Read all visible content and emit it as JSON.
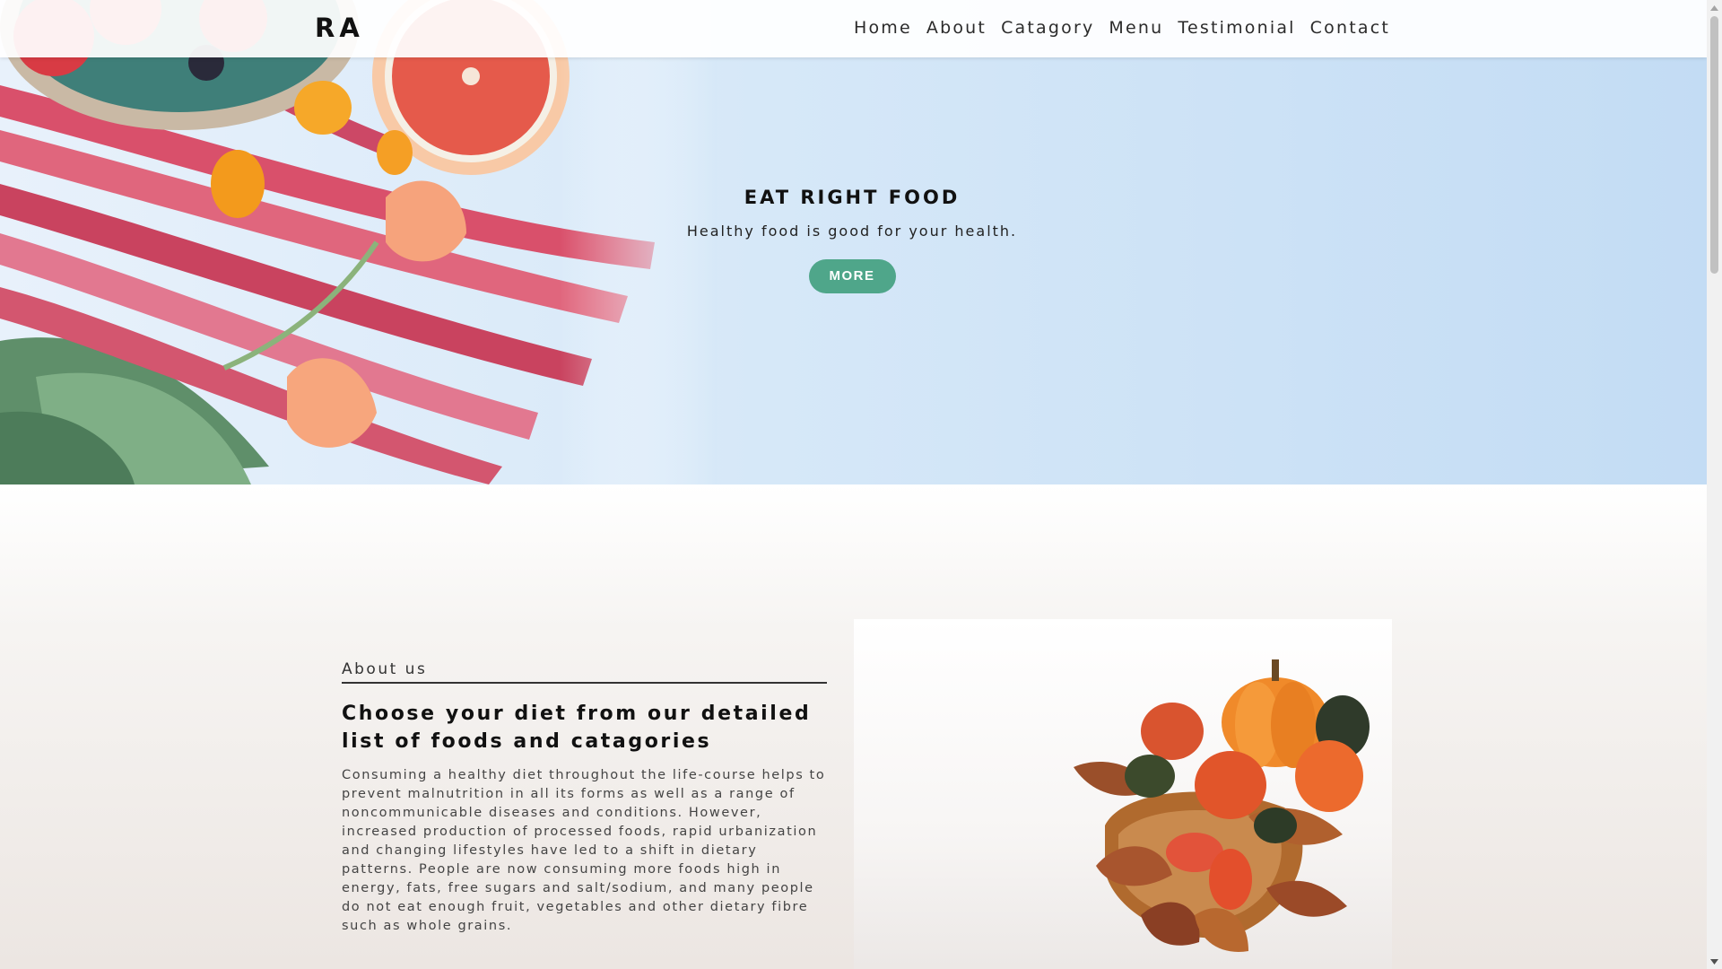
{
  "header": {
    "logo": "RA",
    "nav": [
      {
        "label": "Home"
      },
      {
        "label": "About"
      },
      {
        "label": "Catagory"
      },
      {
        "label": "Menu"
      },
      {
        "label": "Testimonial"
      },
      {
        "label": "Contact"
      }
    ]
  },
  "hero": {
    "title": "EAT RIGHT FOOD",
    "subtitle": "Healthy food is good for your health.",
    "button_label": "MORE",
    "image_icon": "fruits-rhubarb-flowers-photo"
  },
  "about": {
    "kicker": "About us",
    "heading": "Choose your diet from our detailed list of foods and catagories",
    "body": "Consuming a healthy diet throughout the life-course helps to prevent malnutrition in all its forms as well as a range of noncommunicable diseases and conditions. However, increased production of processed foods, rapid urbanization and changing lifestyles have led to a shift in dietary patterns. People are now consuming more foods high in energy, fats, free sugars and salt/sodium, and many people do not eat enough fruit, vegetables and other dietary fibre such as whole grains.",
    "image_icon": "pumpkins-on-board-photo"
  },
  "colors": {
    "accent": "#4fa68a",
    "hero_bg": "#cfe3f6",
    "text_dark": "#111111"
  }
}
